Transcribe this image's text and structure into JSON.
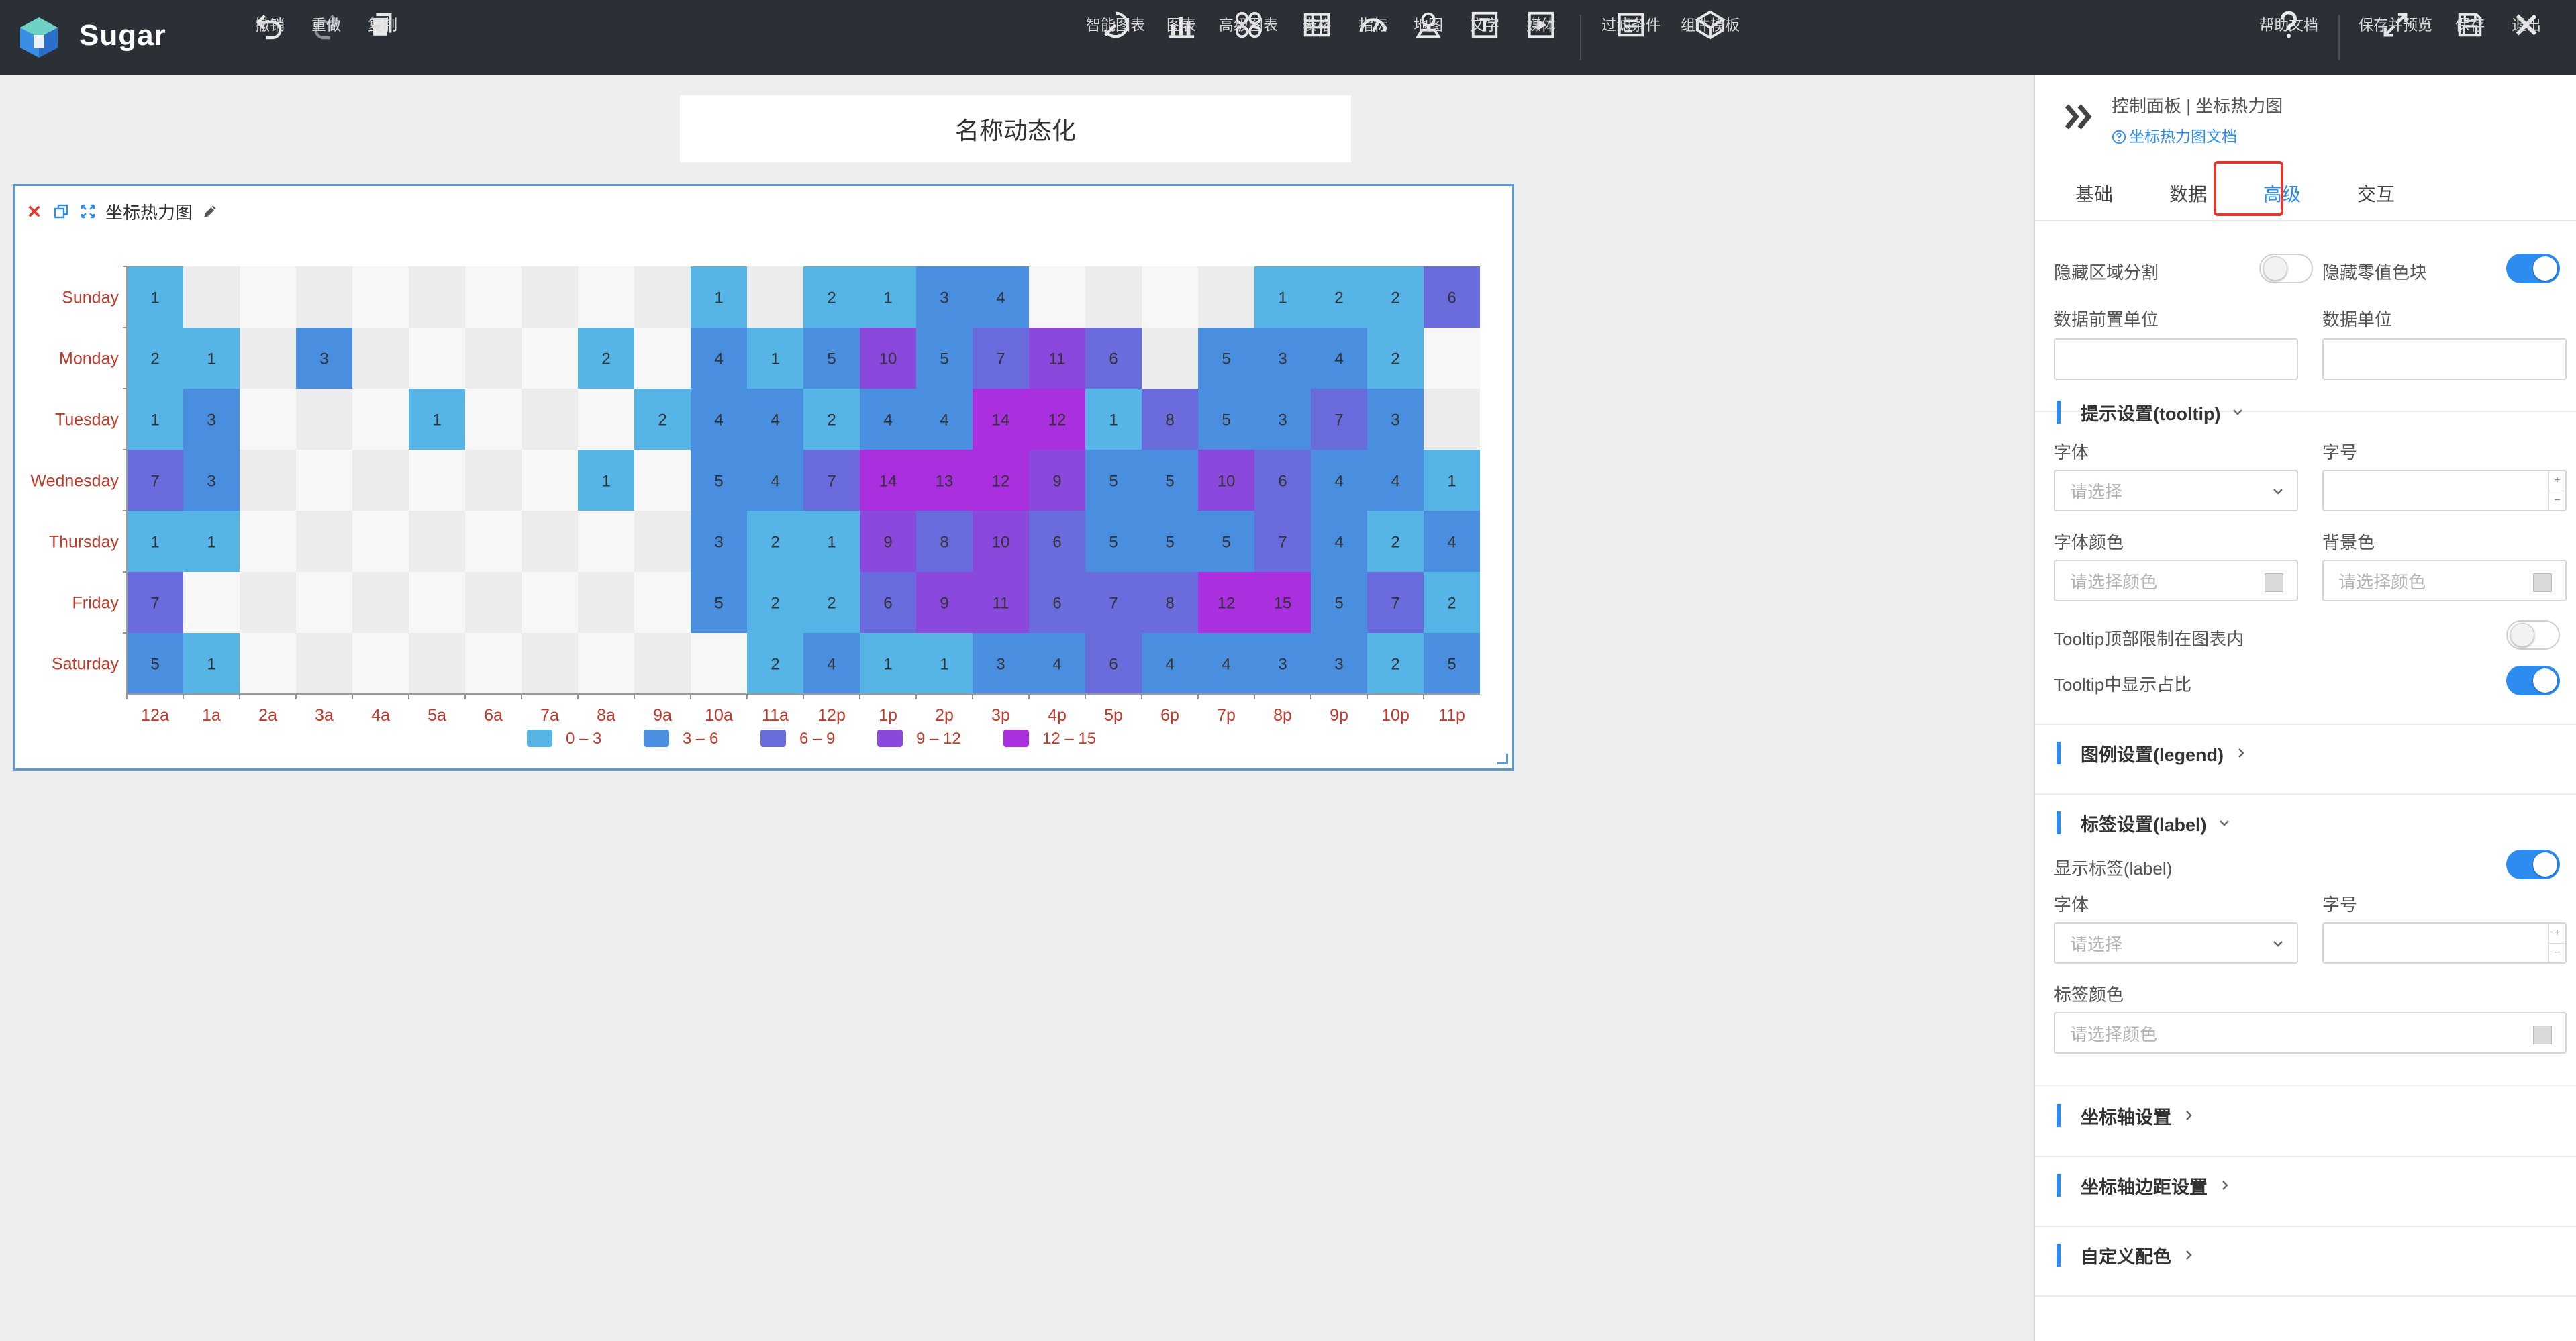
{
  "app": {
    "name": "Sugar"
  },
  "toolbar": {
    "left": [
      {
        "label": "撤销",
        "icon": "undo-icon"
      },
      {
        "label": "重做",
        "icon": "redo-icon"
      },
      {
        "label": "复制",
        "icon": "copy-icon"
      }
    ],
    "center": [
      {
        "label": "智能图表",
        "icon": "smart-chart-icon"
      },
      {
        "label": "图表",
        "icon": "bar-chart-icon"
      },
      {
        "label": "高级图表",
        "icon": "advanced-chart-icon"
      },
      {
        "label": "表格",
        "icon": "table-icon"
      },
      {
        "label": "指标",
        "icon": "gauge-icon"
      },
      {
        "label": "地图",
        "icon": "map-pin-icon"
      },
      {
        "label": "文字",
        "icon": "text-icon"
      },
      {
        "label": "媒体",
        "icon": "media-icon"
      },
      {
        "label": "过滤条件",
        "icon": "filter-icon"
      },
      {
        "label": "组件模板",
        "icon": "template-icon"
      }
    ],
    "right": [
      {
        "label": "帮助文档",
        "icon": "help-icon"
      },
      {
        "label": "保存并预览",
        "icon": "expand-icon"
      },
      {
        "label": "保存",
        "icon": "save-icon"
      },
      {
        "label": "退出",
        "icon": "close-icon"
      }
    ]
  },
  "canvas": {
    "title": "名称动态化",
    "card_title": "坐标热力图"
  },
  "colors": {
    "topbar": "#2b2f36",
    "accent": "#2d8cf0",
    "axis_label": "#c0392b",
    "highlight": "#e0382f",
    "card_border": "#5b9bd5"
  },
  "chart_data": {
    "type": "heatmap",
    "x": [
      "12a",
      "1a",
      "2a",
      "3a",
      "4a",
      "5a",
      "6a",
      "7a",
      "8a",
      "9a",
      "10a",
      "11a",
      "12p",
      "1p",
      "2p",
      "3p",
      "4p",
      "5p",
      "6p",
      "7p",
      "8p",
      "9p",
      "10p",
      "11p"
    ],
    "y": [
      "Sunday",
      "Monday",
      "Tuesday",
      "Wednesday",
      "Thursday",
      "Friday",
      "Saturday"
    ],
    "values": [
      [
        1,
        0,
        0,
        0,
        0,
        0,
        0,
        0,
        0,
        0,
        1,
        0,
        2,
        1,
        3,
        4,
        0,
        0,
        0,
        0,
        1,
        2,
        2,
        6
      ],
      [
        2,
        1,
        0,
        3,
        0,
        0,
        0,
        0,
        2,
        0,
        4,
        1,
        5,
        10,
        5,
        7,
        11,
        6,
        0,
        5,
        3,
        4,
        2,
        0
      ],
      [
        1,
        3,
        0,
        0,
        0,
        1,
        0,
        0,
        0,
        2,
        4,
        4,
        2,
        4,
        4,
        14,
        12,
        1,
        8,
        5,
        3,
        7,
        3,
        0
      ],
      [
        7,
        3,
        0,
        0,
        0,
        0,
        0,
        0,
        1,
        0,
        5,
        4,
        7,
        14,
        13,
        12,
        9,
        5,
        5,
        10,
        6,
        4,
        4,
        1
      ],
      [
        1,
        1,
        0,
        0,
        0,
        0,
        0,
        0,
        0,
        0,
        3,
        2,
        1,
        9,
        8,
        10,
        6,
        5,
        5,
        5,
        7,
        4,
        2,
        4
      ],
      [
        7,
        0,
        0,
        0,
        0,
        0,
        0,
        0,
        0,
        0,
        5,
        2,
        2,
        6,
        9,
        11,
        6,
        7,
        8,
        12,
        15,
        5,
        7,
        2
      ],
      [
        5,
        1,
        0,
        0,
        0,
        0,
        0,
        0,
        0,
        0,
        0,
        2,
        4,
        1,
        1,
        3,
        4,
        6,
        4,
        4,
        3,
        3,
        2,
        5
      ]
    ],
    "legend": [
      {
        "label": "0 – 3",
        "color": "#56b4e6"
      },
      {
        "label": "3 – 6",
        "color": "#4a8ee0"
      },
      {
        "label": "6 – 9",
        "color": "#6a6bdc"
      },
      {
        "label": "9 – 12",
        "color": "#8b48dc"
      },
      {
        "label": "12 – 15",
        "color": "#a92fdf"
      }
    ],
    "zero_colors": [
      "#f7f7f7",
      "#ececec"
    ],
    "label_color": "#333333",
    "legend_position": "bottom-center"
  },
  "panel": {
    "path": "控制面板 | 坐标热力图",
    "doc_link": "坐标热力图文档",
    "tabs": [
      "基础",
      "数据",
      "高级",
      "交互"
    ],
    "active_tab": "高级",
    "fields": {
      "hide_split": {
        "label": "隐藏区域分割",
        "on": false
      },
      "hide_zero": {
        "label": "隐藏零值色块",
        "on": true
      },
      "prefix_unit": {
        "label": "数据前置单位",
        "value": ""
      },
      "data_unit": {
        "label": "数据单位",
        "value": ""
      }
    },
    "tooltip_section": "提示设置(tooltip)",
    "tooltip": {
      "font_label": "字体",
      "font_placeholder": "请选择",
      "size_label": "字号",
      "font_color_label": "字体颜色",
      "font_color_placeholder": "请选择颜色",
      "bg_label": "背景色",
      "bg_placeholder": "请选择颜色",
      "limit_label": "Tooltip顶部限制在图表内",
      "limit_on": false,
      "percent_label": "Tooltip中显示占比",
      "percent_on": true
    },
    "legend_section": "图例设置(legend)",
    "label_section": "标签设置(label)",
    "label": {
      "show_label": "显示标签(label)",
      "show_on": true,
      "font_label": "字体",
      "font_placeholder": "请选择",
      "size_label": "字号",
      "color_label": "标签颜色",
      "color_placeholder": "请选择颜色"
    },
    "axis_section": "坐标轴设置",
    "axis_margin_section": "坐标轴边距设置",
    "custom_color_section": "自定义配色"
  }
}
